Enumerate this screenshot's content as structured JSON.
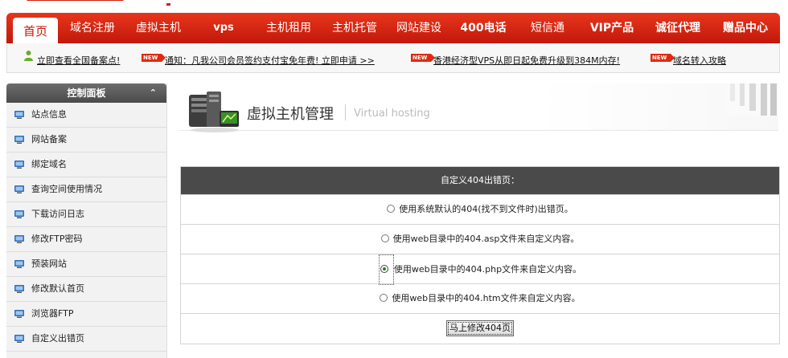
{
  "nav": {
    "items": [
      {
        "label": "首页"
      },
      {
        "label": "域名注册"
      },
      {
        "label": "虚拟主机"
      },
      {
        "label": "vps"
      },
      {
        "label": "主机租用"
      },
      {
        "label": "主机托管"
      },
      {
        "label": "网站建设"
      },
      {
        "label": "400电话"
      },
      {
        "label": "短信通"
      },
      {
        "label": "VIP产品"
      },
      {
        "label": "诚征代理"
      },
      {
        "label": "赠品中心"
      }
    ]
  },
  "notice": {
    "link1": "立即查看全国备案点!",
    "badge": "NEW",
    "link2": "通知：凡我公司会员签约支付宝免年费! 立即申请 >>",
    "link3": "香港经济型VPS从即日起免费升级到384M内存!",
    "link4": "域名转入攻略"
  },
  "sidebar": {
    "title": "控制面板",
    "items": [
      {
        "label": "站点信息"
      },
      {
        "label": "网站备案"
      },
      {
        "label": "绑定域名"
      },
      {
        "label": "查询空间使用情况"
      },
      {
        "label": "下载访问日志"
      },
      {
        "label": "修改FTP密码"
      },
      {
        "label": "预装网站"
      },
      {
        "label": "修改默认首页"
      },
      {
        "label": "浏览器FTP"
      },
      {
        "label": "自定义出错页"
      }
    ]
  },
  "header": {
    "title": "虚拟主机管理",
    "subtitle": "Virtual hosting"
  },
  "form": {
    "heading": "自定义404出错页：",
    "options": [
      {
        "label": "使用系统默认的404(找不到文件时)出错页。",
        "selected": false
      },
      {
        "label": "使用web目录中的404.asp文件来自定义内容。",
        "selected": false
      },
      {
        "label": "使用web目录中的404.php文件来自定义内容。",
        "selected": true
      },
      {
        "label": "使用web目录中的404.htm文件来自定义内容。",
        "selected": false
      }
    ],
    "submit_label": "马上修改404页"
  },
  "colors": {
    "brand_red": "#d21f0a",
    "table_header": "#4a4a4a"
  }
}
